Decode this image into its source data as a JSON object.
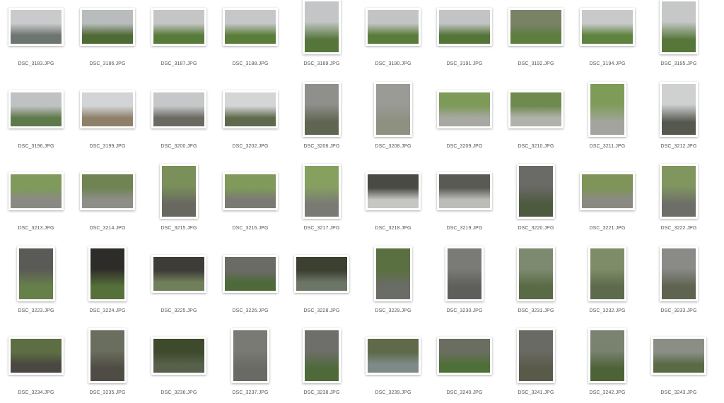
{
  "files": [
    {
      "name": "DSC_3183.JPG",
      "o": "l",
      "c": [
        "#c9cacb",
        "#6d7570"
      ]
    },
    {
      "name": "DSC_3186.JPG",
      "o": "l",
      "c": [
        "#b8bcbd",
        "#4e6a35"
      ]
    },
    {
      "name": "DSC_3187.JPG",
      "o": "l",
      "c": [
        "#c4c6c6",
        "#587a3a"
      ]
    },
    {
      "name": "DSC_3188.JPG",
      "o": "l",
      "c": [
        "#c5c7c8",
        "#5a7e3a"
      ]
    },
    {
      "name": "DSC_3189.JPG",
      "o": "p",
      "c": [
        "#c3c5c6",
        "#55753a"
      ]
    },
    {
      "name": "DSC_3190.JPG",
      "o": "l",
      "c": [
        "#c2c4c5",
        "#5a7c3a"
      ]
    },
    {
      "name": "DSC_3191.JPG",
      "o": "l",
      "c": [
        "#c2c4c5",
        "#547538"
      ]
    },
    {
      "name": "DSC_3192.JPG",
      "o": "l",
      "c": [
        "#7a8266",
        "#5e7e40"
      ]
    },
    {
      "name": "DSC_3194.JPG",
      "o": "l",
      "c": [
        "#c8caca",
        "#5e833e"
      ]
    },
    {
      "name": "DSC_3195.JPG",
      "o": "p",
      "c": [
        "#c6c8c8",
        "#57773a"
      ]
    },
    {
      "name": "DSC_3196.JPG",
      "o": "l",
      "c": [
        "#bfc1c2",
        "#5f7a4a"
      ]
    },
    {
      "name": "DSC_3199.JPG",
      "o": "l",
      "c": [
        "#d2d4d5",
        "#8f806a"
      ]
    },
    {
      "name": "DSC_3200.JPG",
      "o": "l",
      "c": [
        "#c5c7c8",
        "#6b6a62"
      ]
    },
    {
      "name": "DSC_3202.JPG",
      "o": "l",
      "c": [
        "#d4d6d6",
        "#5f6a4c"
      ]
    },
    {
      "name": "DSC_3206.JPG",
      "o": "p",
      "c": [
        "#8f8f8c",
        "#5e6550"
      ]
    },
    {
      "name": "DSC_3208.JPG",
      "o": "p",
      "c": [
        "#9a9a96",
        "#8e9080"
      ]
    },
    {
      "name": "DSC_3209.JPG",
      "o": "l",
      "c": [
        "#7e9a58",
        "#a8a8a2"
      ]
    },
    {
      "name": "DSC_3210.JPG",
      "o": "l",
      "c": [
        "#6f8a4e",
        "#b2b2ac"
      ]
    },
    {
      "name": "DSC_3211.JPG",
      "o": "p",
      "c": [
        "#7e9c58",
        "#a4a49e"
      ]
    },
    {
      "name": "DSC_3212.JPG",
      "o": "p",
      "c": [
        "#cfd1d1",
        "#55584e"
      ]
    },
    {
      "name": "DSC_3213.JPG",
      "o": "l",
      "c": [
        "#7f9a5a",
        "#8a8a84"
      ]
    },
    {
      "name": "DSC_3214.JPG",
      "o": "l",
      "c": [
        "#6f8452",
        "#8e8e88"
      ]
    },
    {
      "name": "DSC_3215.JPG",
      "o": "p",
      "c": [
        "#7a8f5a",
        "#686860"
      ]
    },
    {
      "name": "DSC_3216.JPG",
      "o": "l",
      "c": [
        "#7f9a5a",
        "#7a7a74"
      ]
    },
    {
      "name": "DSC_3217.JPG",
      "o": "p",
      "c": [
        "#86a060",
        "#7a7a74"
      ]
    },
    {
      "name": "DSC_3218.JPG",
      "o": "l",
      "c": [
        "#4a4a44",
        "#c6c6c2"
      ]
    },
    {
      "name": "DSC_3219.JPG",
      "o": "l",
      "c": [
        "#5a5a54",
        "#bcbcb8"
      ]
    },
    {
      "name": "DSC_3220.JPG",
      "o": "p",
      "c": [
        "#6a6a66",
        "#4e5a40"
      ]
    },
    {
      "name": "DSC_3221.JPG",
      "o": "l",
      "c": [
        "#7e9458",
        "#8a8a82"
      ]
    },
    {
      "name": "DSC_3222.JPG",
      "o": "p",
      "c": [
        "#80965e",
        "#6e6e68"
      ]
    },
    {
      "name": "DSC_3223.JPG",
      "o": "p",
      "c": [
        "#5a5a56",
        "#66804a"
      ]
    },
    {
      "name": "DSC_3224.JPG",
      "o": "p",
      "c": [
        "#2e2c28",
        "#56703a"
      ]
    },
    {
      "name": "DSC_3225.JPG",
      "o": "l",
      "c": [
        "#3e3c36",
        "#6f7f5a"
      ]
    },
    {
      "name": "DSC_3226.JPG",
      "o": "l",
      "c": [
        "#6b6b66",
        "#4e6a3a"
      ]
    },
    {
      "name": "DSC_3228.JPG",
      "o": "l",
      "c": [
        "#3c4030",
        "#6c7666"
      ]
    },
    {
      "name": "DSC_3229.JPG",
      "o": "p",
      "c": [
        "#5a7040",
        "#6a6c66"
      ]
    },
    {
      "name": "DSC_3230.JPG",
      "o": "p",
      "c": [
        "#7a7a76",
        "#5e5e5a"
      ]
    },
    {
      "name": "DSC_3231.JPG",
      "o": "p",
      "c": [
        "#7e8a70",
        "#5a6a44"
      ]
    },
    {
      "name": "DSC_3232.JPG",
      "o": "p",
      "c": [
        "#7e8c68",
        "#5e6a4c"
      ]
    },
    {
      "name": "DSC_3233.JPG",
      "o": "p",
      "c": [
        "#8a8a86",
        "#5e6450"
      ]
    },
    {
      "name": "DSC_3234.JPG",
      "o": "l",
      "c": [
        "#5e6e44",
        "#4a4840"
      ]
    },
    {
      "name": "DSC_3235.JPG",
      "o": "p",
      "c": [
        "#6a6e5e",
        "#4e4c44"
      ]
    },
    {
      "name": "DSC_3236.JPG",
      "o": "l",
      "c": [
        "#3e4a2c",
        "#56604a"
      ]
    },
    {
      "name": "DSC_3237.JPG",
      "o": "p",
      "c": [
        "#7a7a74",
        "#6a6a64"
      ]
    },
    {
      "name": "DSC_3238.JPG",
      "o": "p",
      "c": [
        "#6e6e6a",
        "#4e6a3a"
      ]
    },
    {
      "name": "DSC_3239.JPG",
      "o": "l",
      "c": [
        "#5e6a4a",
        "#7e8a88"
      ]
    },
    {
      "name": "DSC_3240.JPG",
      "o": "l",
      "c": [
        "#6a6e60",
        "#4e7038"
      ]
    },
    {
      "name": "DSC_3241.JPG",
      "o": "p",
      "c": [
        "#6a6a64",
        "#5a5a4a"
      ]
    },
    {
      "name": "DSC_3242.JPG",
      "o": "p",
      "c": [
        "#7a8270",
        "#4e6238"
      ]
    },
    {
      "name": "DSC_3243.JPG",
      "o": "l",
      "c": [
        "#8a8e84",
        "#5a6a44"
      ]
    }
  ]
}
